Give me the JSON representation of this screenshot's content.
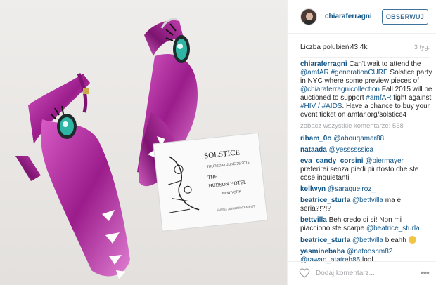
{
  "post": {
    "image_alt": "Metallic pink stiletto heels with eye and teeth details next to a Solstice invitation card",
    "card": {
      "title": "SOLSTICE",
      "date": "THURSDAY JUNE 25 2015",
      "venue_line1": "THE",
      "venue_line2": "HUDSON HOTEL",
      "city": "NEW YORK",
      "extra": "EVENT ANNOUNCEMENT"
    }
  },
  "header": {
    "username": "chiaraferragni",
    "follow_label": "OBSERWUJ"
  },
  "meta": {
    "likes_label": "Liczba polubień:",
    "likes_count": "43.4k",
    "time_ago": "3 tyg."
  },
  "caption": {
    "user": "chiaraferragni",
    "parts": [
      "Can't wait to attend the ",
      "@amfAR #generationCURE",
      " Solstice party in NYC where some preview pieces of ",
      "@chiaraferragnicollection",
      " Fall 2015 will be auctioned to support ",
      "#amfAR",
      " fight against ",
      "#HIV / #AIDS",
      ". Have a chance to buy your event ticket on amfar.org/solstice4"
    ]
  },
  "view_all": "zobacz wszystkie komentarze: 538",
  "comments": [
    {
      "user": "riham_0o",
      "text": "",
      "mention": "@abouqamar88"
    },
    {
      "user": "nataada",
      "text": "",
      "mention": "@yessssssica"
    },
    {
      "user": "eva_candy_corsini",
      "text": " preferirei senza piedi piuttosto che ste cose inquietanti",
      "mention": "@piermayer"
    },
    {
      "user": "kellwyn",
      "text": "",
      "mention": "@saraqueiroz_"
    },
    {
      "user": "beatrice_sturla",
      "text": " ma è seria?!?!?",
      "mention": "@bettvilla"
    },
    {
      "user": "bettvilla",
      "text": "Beh credo di si! Non mi piacciono ste scarpe ",
      "mention": "@beatrice_sturla"
    },
    {
      "user": "beatrice_sturla",
      "text": " bleahh",
      "mention": "@bettvilla"
    },
    {
      "user": "yasminebaba",
      "text": "",
      "mention": "@natooshm82 @rawan_atatreh85",
      "tail": " lool"
    }
  ],
  "footer": {
    "comment_placeholder": "Dodaj komentarz...",
    "more_label": "•••"
  },
  "icons": {
    "heart": "heart-icon",
    "more": "more-options-icon"
  },
  "colors": {
    "link": "#125688",
    "follow": "#3f729b",
    "muted": "#a5a7aa",
    "shoe": "#b0279a"
  }
}
